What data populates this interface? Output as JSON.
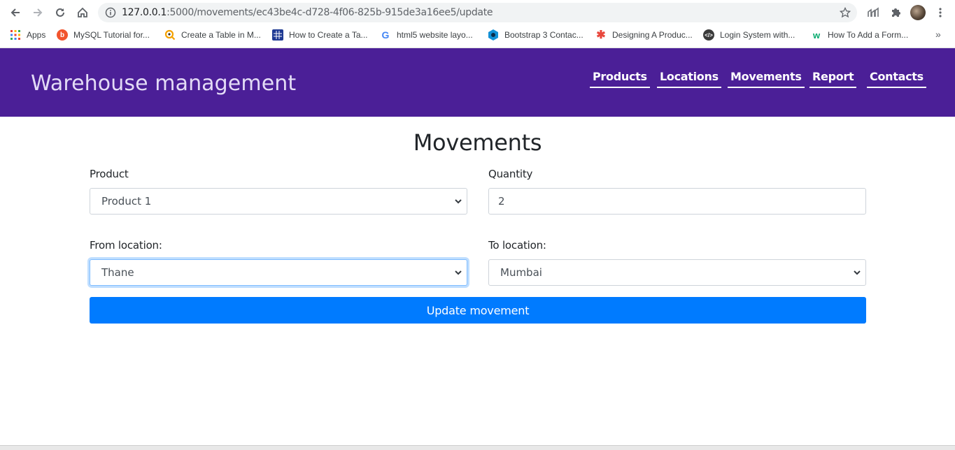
{
  "browser": {
    "url_host": "127.0.0.1",
    "url_rest": ":5000/movements/ec43be4c-d728-4f06-825b-915de3a16ee5/update",
    "bookmarks": [
      {
        "label": "Apps",
        "icon": "apps-grid-icon"
      },
      {
        "label": "MySQL Tutorial for...",
        "icon": "mysql-favicon"
      },
      {
        "label": "Create a Table in M...",
        "icon": "search-favicon"
      },
      {
        "label": "How to Create a Ta...",
        "icon": "table-favicon"
      },
      {
        "label": "html5 website layo...",
        "icon": "google-favicon"
      },
      {
        "label": "Bootstrap 3 Contac...",
        "icon": "hexagon-favicon"
      },
      {
        "label": "Designing A Produc...",
        "icon": "asterisk-favicon"
      },
      {
        "label": "Login System with...",
        "icon": "code-favicon"
      },
      {
        "label": "How To Add a Form...",
        "icon": "w-favicon"
      }
    ],
    "more_label": "»"
  },
  "navbar": {
    "brand": "Warehouse management",
    "links": [
      "Products",
      "Locations",
      "Movements",
      "Report",
      "Contacts"
    ]
  },
  "form": {
    "title": "Movements",
    "product_label": "Product",
    "product_value": "Product 1",
    "quantity_label": "Quantity",
    "quantity_value": "2",
    "from_label": "From location:",
    "from_value": "Thane",
    "to_label": "To location:",
    "to_value": "Mumbai",
    "submit_label": "Update movement"
  },
  "colors": {
    "navbar_bg": "#4b1f97",
    "brand_text": "#e3dbf6",
    "primary_button": "#007bff",
    "focus_ring": "#80bdff"
  }
}
